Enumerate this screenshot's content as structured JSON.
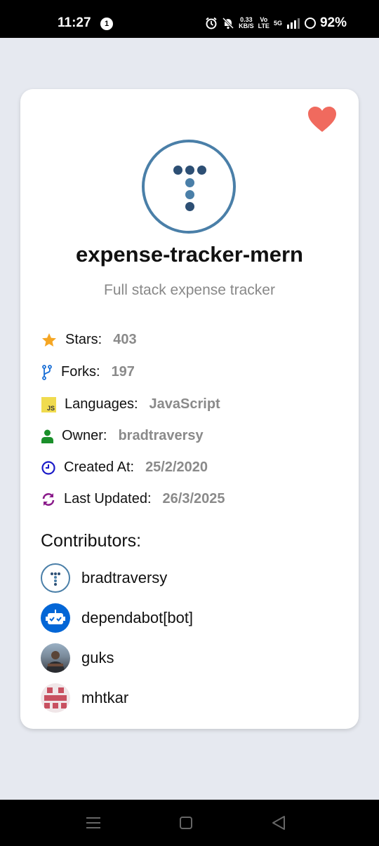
{
  "status_bar": {
    "time": "11:27",
    "notification_count": "1",
    "net_speed_top": "0.33",
    "net_speed_bottom": "KB/S",
    "volte_top": "Vo",
    "volte_bottom": "LTE",
    "network": "5G",
    "battery": "92%"
  },
  "repo": {
    "name": "expense-tracker-mern",
    "description": "Full stack expense tracker",
    "favorited": true
  },
  "info": {
    "stars_label": "Stars:",
    "stars_value": "403",
    "forks_label": "Forks:",
    "forks_value": "197",
    "languages_label": "Languages:",
    "languages_value": "JavaScript",
    "js_badge": "JS",
    "owner_label": "Owner:",
    "owner_value": "bradtraversy",
    "created_label": "Created At:",
    "created_value": "25/2/2020",
    "updated_label": "Last Updated:",
    "updated_value": "26/3/2025"
  },
  "contributors_title": "Contributors:",
  "contributors": [
    {
      "name": "bradtraversy",
      "avatar": "logo-avatar"
    },
    {
      "name": "dependabot[bot]",
      "avatar": "bot-avatar"
    },
    {
      "name": "guks",
      "avatar": "photo-avatar"
    },
    {
      "name": "mhtkar",
      "avatar": "identicon-avatar"
    }
  ],
  "colors": {
    "star": "#f5a623",
    "fork": "#1a6fd6",
    "js": "#f0db4f",
    "owner": "#1a8f2a",
    "clock": "#1a1ac8",
    "sync": "#8a1a8a",
    "heart": "#f06a5e",
    "logo": "#4a7fa8"
  }
}
